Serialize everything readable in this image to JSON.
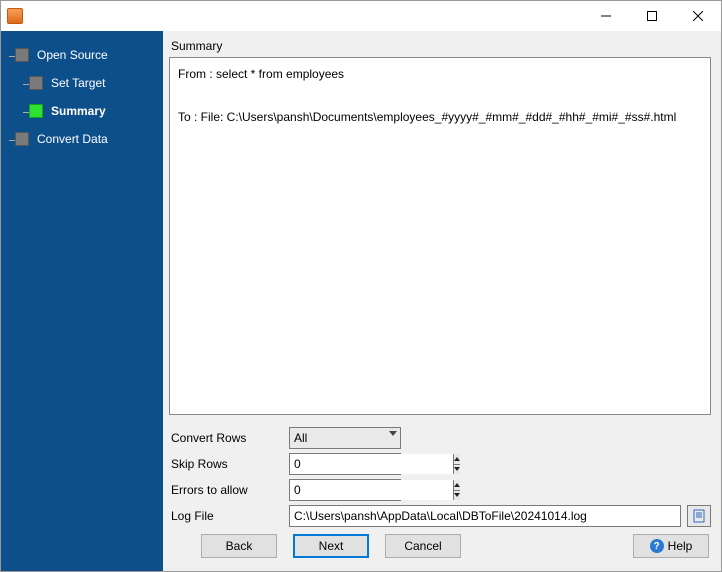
{
  "nav": {
    "items": [
      {
        "label": "Open Source"
      },
      {
        "label": "Set Target"
      },
      {
        "label": "Summary"
      },
      {
        "label": "Convert Data"
      }
    ]
  },
  "main": {
    "section_title": "Summary",
    "from_line": "From : select * from employees",
    "to_line": "To : File: C:\\Users\\pansh\\Documents\\employees_#yyyy#_#mm#_#dd#_#hh#_#mi#_#ss#.html"
  },
  "form": {
    "convert_rows_label": "Convert Rows",
    "convert_rows_value": "All",
    "skip_rows_label": "Skip Rows",
    "skip_rows_value": "0",
    "errors_label": "Errors to allow",
    "errors_value": "0",
    "log_label": "Log File",
    "log_value": "C:\\Users\\pansh\\AppData\\Local\\DBToFile\\20241014.log"
  },
  "buttons": {
    "back": "Back",
    "next": "Next",
    "cancel": "Cancel",
    "help": "Help"
  }
}
